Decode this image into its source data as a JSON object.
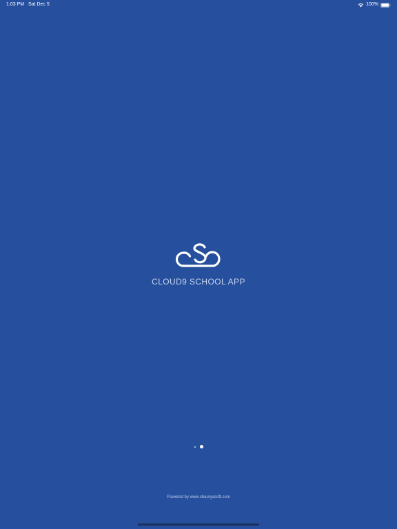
{
  "status_bar": {
    "time": "1:03 PM",
    "date": "Sat Dec 5",
    "battery_percent": "100%",
    "icons": [
      "wifi-icon",
      "battery-icon"
    ]
  },
  "splash": {
    "app_title": "CLOUD9 SCHOOL APP",
    "logo_icon": "cloud-logo-icon"
  },
  "page_indicator": {
    "total_pages": 2,
    "current_page": 2
  },
  "footer": {
    "powered_by": "Powered by www.shauryasoft.com"
  },
  "colors": {
    "background": "#26509e",
    "title_text": "#c7d4f0",
    "foreground": "#ffffff"
  }
}
